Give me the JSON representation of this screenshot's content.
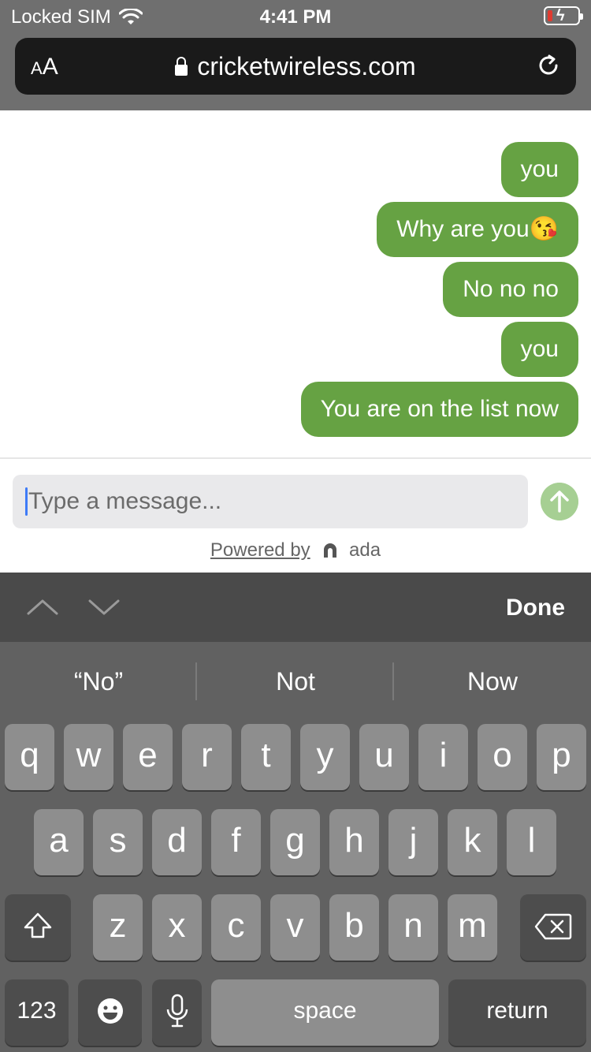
{
  "status": {
    "carrier": "Locked SIM",
    "time": "4:41 PM"
  },
  "browser": {
    "aa": "AA",
    "url": "cricketwireless.com"
  },
  "chat": {
    "messages": [
      "you",
      "Why are you😘",
      "No no no",
      "you",
      "You are on the list now"
    ],
    "input_placeholder": "Type a message...",
    "powered_by": "Powered by",
    "brand": "ada",
    "bubble_color": "#66a243"
  },
  "accessory": {
    "done": "Done"
  },
  "keyboard": {
    "suggestions": [
      "“No”",
      "Not",
      "Now"
    ],
    "row1": [
      "q",
      "w",
      "e",
      "r",
      "t",
      "y",
      "u",
      "i",
      "o",
      "p"
    ],
    "row2": [
      "a",
      "s",
      "d",
      "f",
      "g",
      "h",
      "j",
      "k",
      "l"
    ],
    "row3": [
      "z",
      "x",
      "c",
      "v",
      "b",
      "n",
      "m"
    ],
    "numbers": "123",
    "space": "space",
    "return": "return"
  }
}
